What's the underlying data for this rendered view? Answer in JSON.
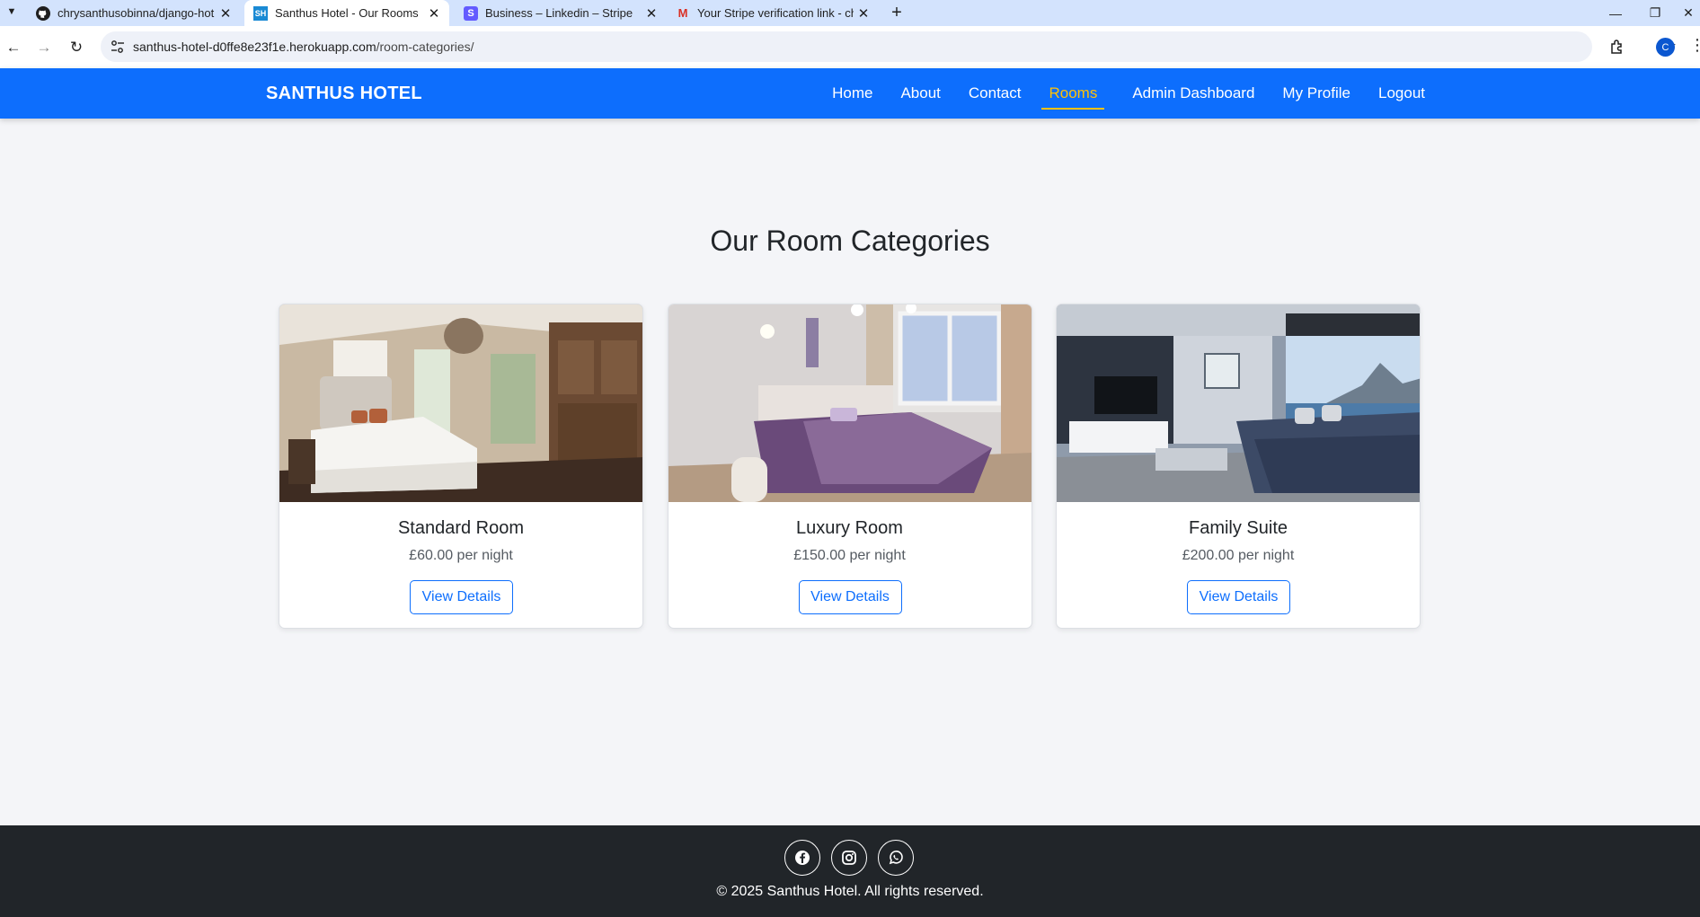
{
  "browser": {
    "tabs": [
      {
        "title": "chrysanthusobinna/django-hot",
        "favicon": "github-icon",
        "active": false
      },
      {
        "title": "Santhus Hotel - Our Rooms",
        "favicon": "sh-site-icon",
        "favicon_text": "SH",
        "active": true
      },
      {
        "title": "Business – Linkedin – Stripe",
        "favicon": "stripe-icon",
        "favicon_text": "S",
        "active": false
      },
      {
        "title": "Your Stripe verification link - ch",
        "favicon": "gmail-icon",
        "favicon_text": "M",
        "active": false
      }
    ],
    "url_host": "santhus-hotel-d0ffe8e23f1e.herokuapp.com",
    "url_path": "/room-categories/",
    "profile_initial": "C"
  },
  "nav": {
    "brand": "SANTHUS HOTEL",
    "links": [
      "Home",
      "About",
      "Contact",
      "Rooms",
      "Admin Dashboard",
      "My Profile",
      "Logout"
    ],
    "active": "Rooms"
  },
  "main": {
    "title": "Our Room Categories",
    "rooms": [
      {
        "name": "Standard Room",
        "price": "£60.00 per night",
        "button": "View Details"
      },
      {
        "name": "Luxury Room",
        "price": "£150.00 per night",
        "button": "View Details"
      },
      {
        "name": "Family Suite",
        "price": "£200.00 per night",
        "button": "View Details"
      }
    ]
  },
  "footer": {
    "socials": [
      "facebook-icon",
      "instagram-icon",
      "whatsapp-icon"
    ],
    "copyright": "© 2025 Santhus Hotel. All rights reserved."
  },
  "colors": {
    "primary": "#0d6efd",
    "active_link": "#ffc107",
    "footer_bg": "#212529",
    "page_bg": "#f4f5f8"
  }
}
